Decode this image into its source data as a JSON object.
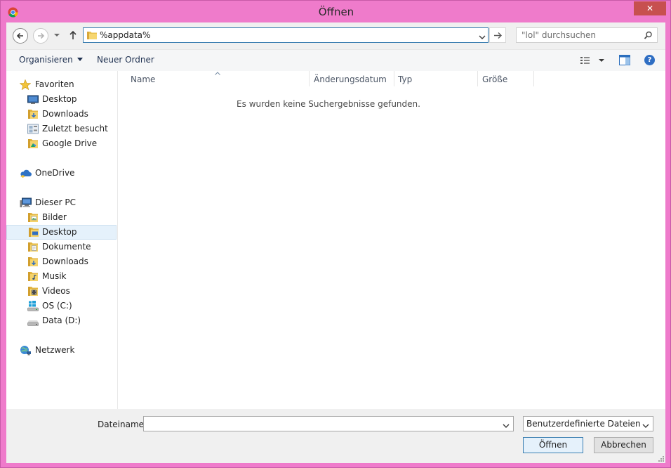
{
  "window": {
    "title": "Öffnen",
    "close_symbol": "✕"
  },
  "nav": {
    "address": "%appdata%",
    "search_placeholder": "\"lol\" durchsuchen"
  },
  "toolbar": {
    "organize_label": "Organisieren",
    "new_folder_label": "Neuer Ordner",
    "help_symbol": "?"
  },
  "sidebar": {
    "favorites": {
      "label": "Favoriten",
      "items": [
        {
          "label": "Desktop",
          "icon": "desktop-icon"
        },
        {
          "label": "Downloads",
          "icon": "folder-icon"
        },
        {
          "label": "Zuletzt besucht",
          "icon": "recent-places-icon"
        },
        {
          "label": "Google Drive",
          "icon": "folder-icon"
        }
      ]
    },
    "onedrive": {
      "label": "OneDrive",
      "icon": "cloud-icon"
    },
    "this_pc": {
      "label": "Dieser PC",
      "items": [
        {
          "label": "Bilder",
          "icon": "folder-icon"
        },
        {
          "label": "Desktop",
          "icon": "folder-icon",
          "selected": true
        },
        {
          "label": "Dokumente",
          "icon": "folder-icon"
        },
        {
          "label": "Downloads",
          "icon": "folder-icon"
        },
        {
          "label": "Musik",
          "icon": "folder-icon"
        },
        {
          "label": "Videos",
          "icon": "folder-icon"
        },
        {
          "label": "OS (C:)",
          "icon": "windows-drive-icon"
        },
        {
          "label": "Data (D:)",
          "icon": "drive-icon"
        }
      ]
    },
    "network": {
      "label": "Netzwerk",
      "icon": "network-icon"
    }
  },
  "filelist": {
    "columns": [
      "Name",
      "Änderungsdatum",
      "Typ",
      "Größe"
    ],
    "empty_message": "Es wurden keine Suchergebnisse gefunden."
  },
  "footer": {
    "filename_label": "Dateiname:",
    "filename_value": "",
    "filetype_value": "Benutzerdefinierte Dateien",
    "open_label": "Öffnen",
    "cancel_label": "Abbrechen"
  },
  "colors": {
    "frame": "#ef7bcb",
    "close": "#c7504f",
    "accent": "#3c7fb1"
  }
}
